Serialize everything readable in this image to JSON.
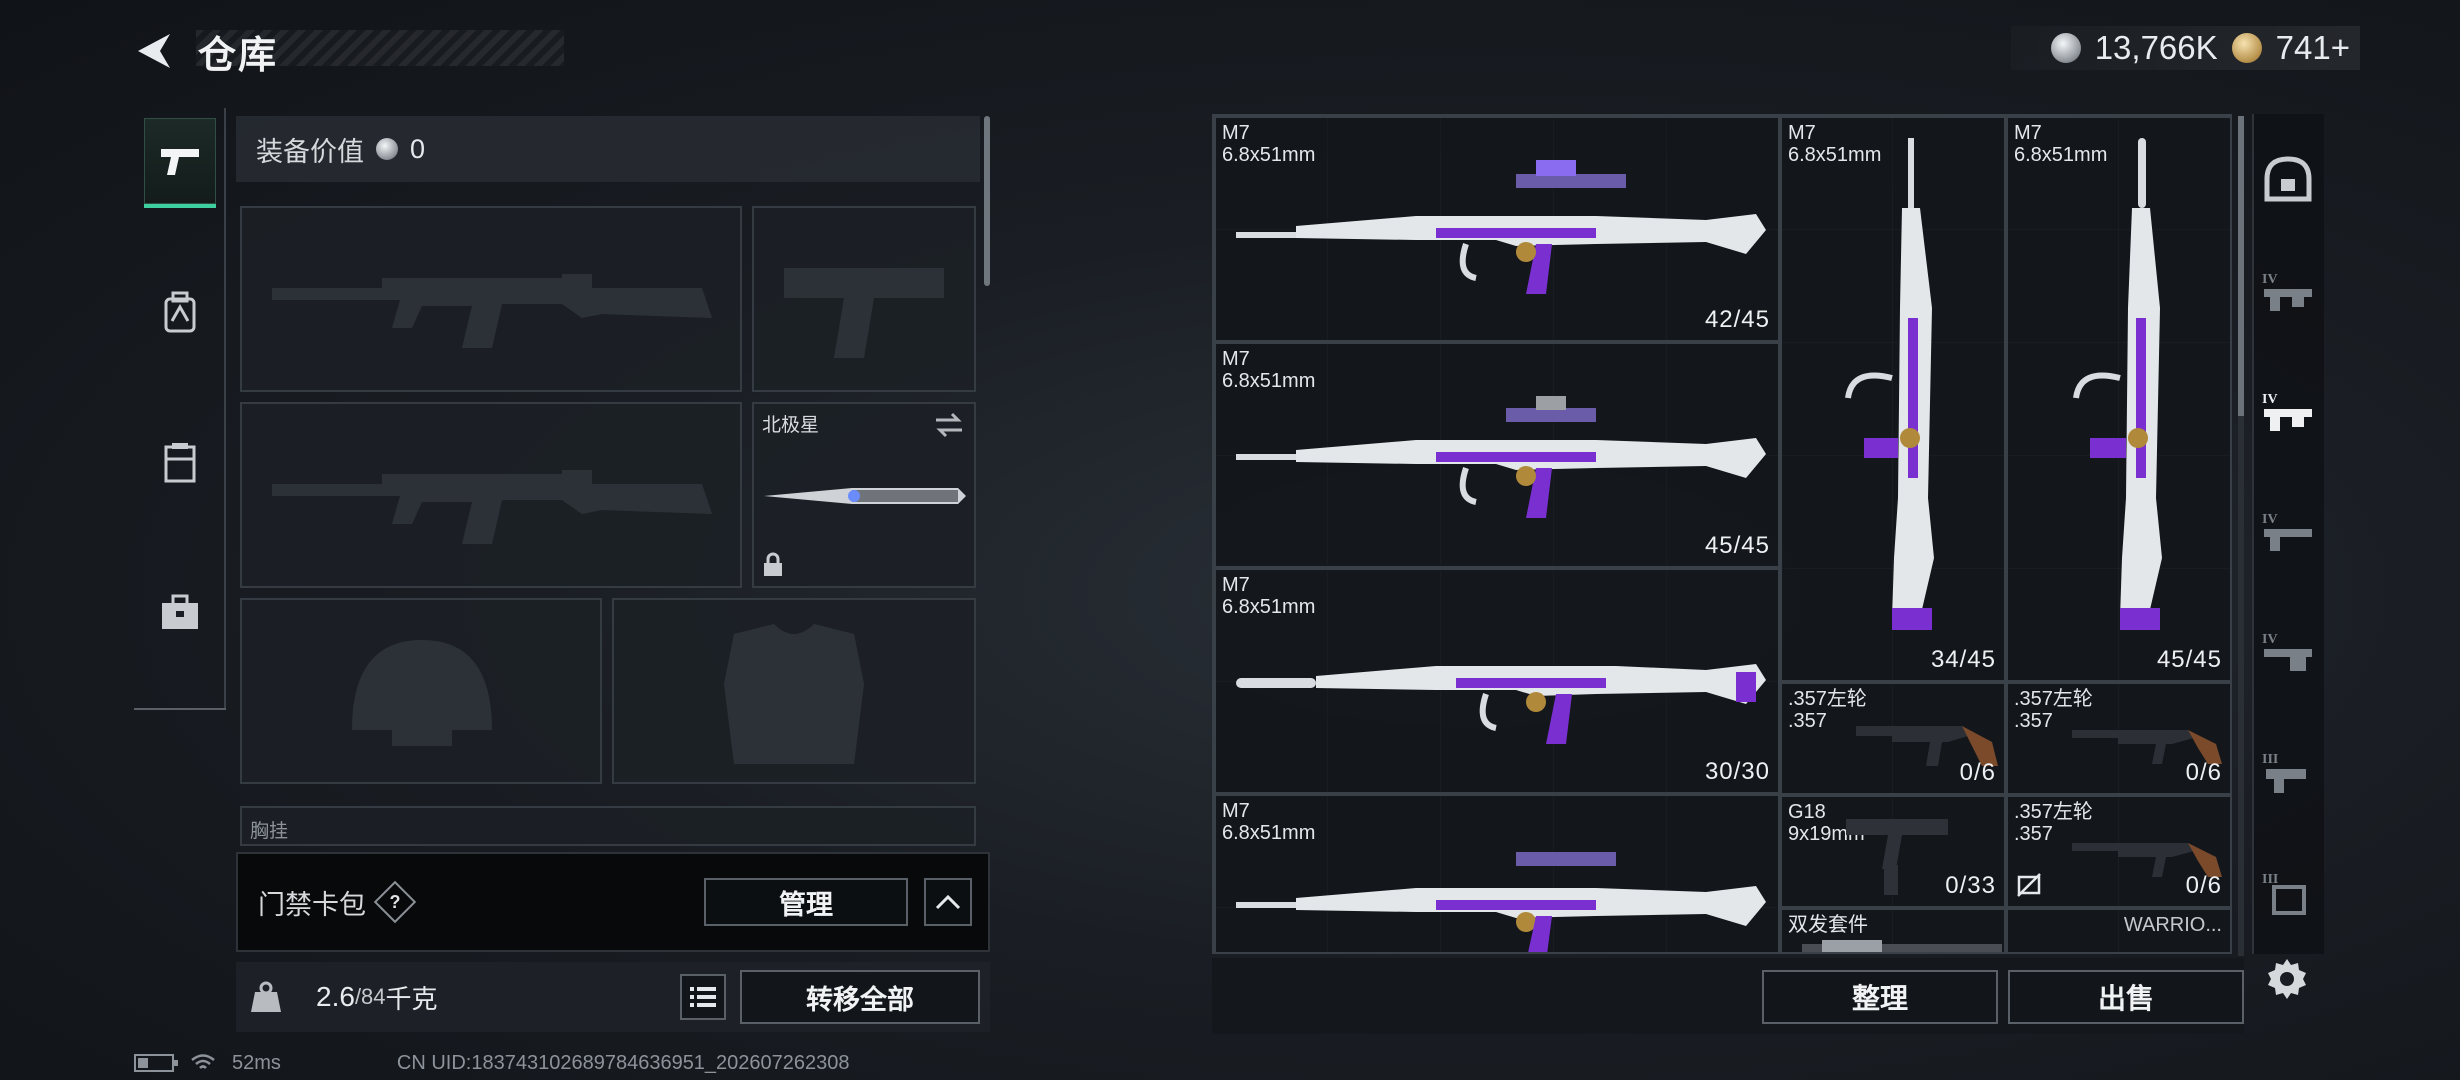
{
  "header": {
    "title": "仓库"
  },
  "currency": [
    {
      "icon": "silver-coin-icon",
      "value": "13,766K"
    },
    {
      "icon": "gold-coin-icon",
      "value": "741+"
    }
  ],
  "left_tabs": [
    {
      "icon": "weapon-tab-icon",
      "active": true
    },
    {
      "icon": "backpack-tab-icon",
      "active": false
    },
    {
      "icon": "rig-tab-icon",
      "active": false
    },
    {
      "icon": "toolbox-tab-icon",
      "active": false
    }
  ],
  "equipment": {
    "value_label": "装备价值",
    "value": "0",
    "knife_label": "北极星",
    "chest_label": "胸挂"
  },
  "keycard": {
    "label": "门禁卡包",
    "help": "?",
    "manage_label": "管理"
  },
  "weight": {
    "current": "2.6",
    "max": "/84",
    "unit": "千克",
    "transfer_label": "转移全部"
  },
  "status": {
    "ping": "52ms",
    "uid": "CN UID:18374310268978463695​1_202607262308"
  },
  "items": [
    {
      "name": "M7",
      "caliber": "6.8x51mm",
      "ammo": "42/45"
    },
    {
      "name": "M7",
      "caliber": "6.8x51mm",
      "ammo": "45/45"
    },
    {
      "name": "M7",
      "caliber": "6.8x51mm",
      "ammo": "30/30"
    },
    {
      "name": "M7",
      "caliber": "6.8x51mm",
      "ammo": ""
    },
    {
      "name": "M7",
      "caliber": "6.8x51mm",
      "ammo": "34/45"
    },
    {
      "name": "M7",
      "caliber": "6.8x51mm",
      "ammo": "45/45"
    },
    {
      "name": ".357左轮",
      "caliber": ".357",
      "ammo": "0/6"
    },
    {
      "name": ".357左轮",
      "caliber": ".357",
      "ammo": "0/6"
    },
    {
      "name": "G18",
      "caliber": "9x19mm",
      "ammo": "0/33"
    },
    {
      "name": ".357左轮",
      "caliber": ".357",
      "ammo": "0/6"
    },
    {
      "name": "双发套件",
      "caliber": "",
      "ammo": ""
    },
    {
      "name": "WARRIO...",
      "caliber": "",
      "ammo": ""
    }
  ],
  "actions": {
    "sort_label": "整理",
    "sell_label": "出售"
  },
  "right_filters": [
    {
      "icon": "helmet-filter-icon",
      "tier": ""
    },
    {
      "icon": "rifle-filter-icon",
      "tier": "IV"
    },
    {
      "icon": "rifle-filter-icon",
      "tier": "IV"
    },
    {
      "icon": "rifle-filter-icon",
      "tier": "IV"
    },
    {
      "icon": "rifle-filter-icon",
      "tier": "IV"
    },
    {
      "icon": "pistol-filter-icon",
      "tier": "III"
    },
    {
      "icon": "armor-filter-icon",
      "tier": "III"
    }
  ],
  "colors": {
    "accent": "#3fd0a0",
    "skin_purple": "#7a2fd0",
    "panel": "#161a1f"
  }
}
